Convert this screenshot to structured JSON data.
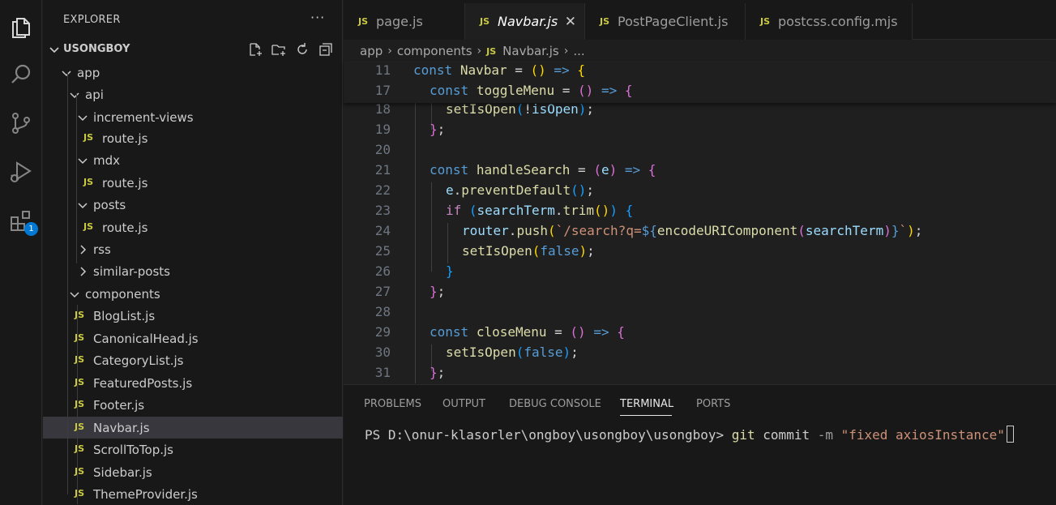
{
  "activity_bar": {
    "icons": [
      "explorer-icon",
      "search-icon",
      "source-control-icon",
      "run-debug-icon",
      "extensions-icon"
    ],
    "extensions_badge": "1"
  },
  "sidebar": {
    "title": "EXPLORER",
    "more": "···",
    "root": "USONGBOY",
    "tree": [
      {
        "label": "app",
        "type": "folder",
        "expanded": true,
        "depth": 0
      },
      {
        "label": "api",
        "type": "folder",
        "expanded": true,
        "depth": 1
      },
      {
        "label": "increment-views",
        "type": "folder",
        "expanded": true,
        "depth": 2
      },
      {
        "label": "route.js",
        "type": "file",
        "depth": 3
      },
      {
        "label": "mdx",
        "type": "folder",
        "expanded": true,
        "depth": 2
      },
      {
        "label": "route.js",
        "type": "file",
        "depth": 3
      },
      {
        "label": "posts",
        "type": "folder",
        "expanded": true,
        "depth": 2
      },
      {
        "label": "route.js",
        "type": "file",
        "depth": 3
      },
      {
        "label": "rss",
        "type": "folder",
        "expanded": false,
        "depth": 2
      },
      {
        "label": "similar-posts",
        "type": "folder",
        "expanded": false,
        "depth": 2
      },
      {
        "label": "components",
        "type": "folder",
        "expanded": true,
        "depth": 1
      },
      {
        "label": "BlogList.js",
        "type": "file",
        "depth": 2
      },
      {
        "label": "CanonicalHead.js",
        "type": "file",
        "depth": 2
      },
      {
        "label": "CategoryList.js",
        "type": "file",
        "depth": 2
      },
      {
        "label": "FeaturedPosts.js",
        "type": "file",
        "depth": 2
      },
      {
        "label": "Footer.js",
        "type": "file",
        "depth": 2
      },
      {
        "label": "Navbar.js",
        "type": "file",
        "depth": 2,
        "selected": true
      },
      {
        "label": "ScrollToTop.js",
        "type": "file",
        "depth": 2
      },
      {
        "label": "Sidebar.js",
        "type": "file",
        "depth": 2
      },
      {
        "label": "ThemeProvider.js",
        "type": "file",
        "depth": 2
      }
    ]
  },
  "file_icon_text": "JS",
  "tabs": [
    {
      "label": "page.js",
      "active": false
    },
    {
      "label": "Navbar.js",
      "active": true,
      "close": "✕"
    },
    {
      "label": "PostPageClient.js",
      "active": false
    },
    {
      "label": "postcss.config.mjs",
      "active": false
    }
  ],
  "breadcrumb": {
    "parts": [
      "app",
      "components"
    ],
    "file": "Navbar.js",
    "tail": "..."
  },
  "editor": {
    "lines": [
      {
        "n": "11",
        "sticky": true
      },
      {
        "n": "17",
        "sticky": true
      },
      {
        "n": "18"
      },
      {
        "n": "19"
      },
      {
        "n": "20"
      },
      {
        "n": "21"
      },
      {
        "n": "22"
      },
      {
        "n": "23"
      },
      {
        "n": "24"
      },
      {
        "n": "25"
      },
      {
        "n": "26"
      },
      {
        "n": "27"
      },
      {
        "n": "28"
      },
      {
        "n": "29"
      },
      {
        "n": "30"
      },
      {
        "n": "31"
      }
    ],
    "tokens": {
      "const": "const",
      "navbar": "Navbar",
      "eq": " = ",
      "arrow": " => ",
      "toggleMenu": "toggleMenu",
      "setIsOpen": "setIsOpen",
      "isOpen": "isOpen",
      "bang": "!",
      "semi": ";",
      "handleSearch": "handleSearch",
      "e": "e",
      "dot": ".",
      "preventDefault": "preventDefault",
      "if": "if",
      "searchTerm": "searchTerm",
      "trim": "trim",
      "router": "router",
      "push": "push",
      "tick": "`",
      "tplStr": "/search?q=",
      "tplOpen": "${",
      "tplClose": "}",
      "encodeURIComponent": "encodeURIComponent",
      "false": "false",
      "closeMenu": "closeMenu"
    }
  },
  "panel": {
    "tabs": [
      "PROBLEMS",
      "OUTPUT",
      "DEBUG CONSOLE",
      "TERMINAL",
      "PORTS"
    ],
    "active_tab": "TERMINAL",
    "terminal": {
      "prompt": "PS D:\\onur-klasorler\\ongboy\\usongboy\\usongboy> ",
      "cmd": "git",
      "arg": " commit ",
      "flag": "-m",
      "str": " \"fixed axiosInstance\""
    }
  }
}
